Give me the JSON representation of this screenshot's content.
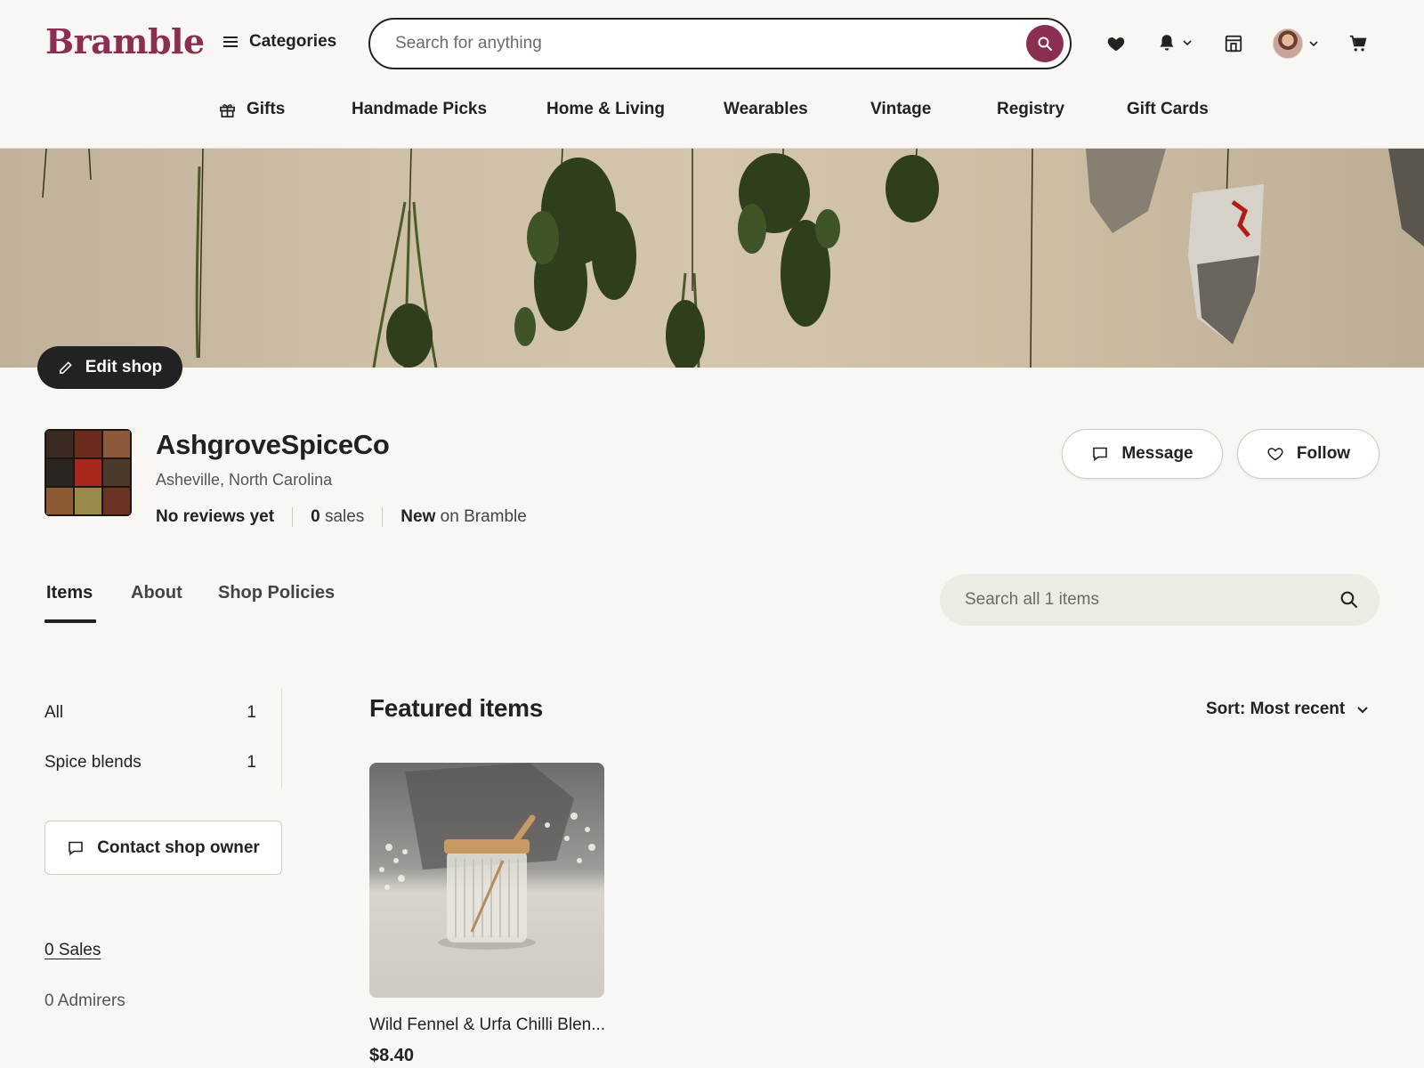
{
  "header": {
    "logo": "Bramble",
    "categories_label": "Categories",
    "search_placeholder": "Search for anything"
  },
  "icons": {
    "favorites": "heart-icon",
    "notifications": "bell-icon",
    "shop_manager": "shop-icon",
    "account": "avatar",
    "cart": "cart-icon"
  },
  "colors": {
    "brand": "#8a2e52",
    "dark_button": "#222222",
    "background": "#f8f7f4"
  },
  "nav": {
    "items": [
      {
        "label": "Gifts",
        "icon": "gift-icon"
      },
      {
        "label": "Handmade Picks"
      },
      {
        "label": "Home & Living"
      },
      {
        "label": "Wearables"
      },
      {
        "label": "Vintage"
      },
      {
        "label": "Registry"
      },
      {
        "label": "Gift Cards"
      }
    ]
  },
  "banner": {
    "edit_label": "Edit shop"
  },
  "shop": {
    "name": "AshgroveSpiceCo",
    "location": "Asheville, North Carolina",
    "reviews": "No reviews yet",
    "sales_count": "0",
    "sales_word": "sales",
    "age_label": "New",
    "age_suffix": "on Bramble",
    "message_label": "Message",
    "follow_label": "Follow"
  },
  "tabs": [
    {
      "label": "Items",
      "active": true
    },
    {
      "label": "About",
      "active": false
    },
    {
      "label": "Shop Policies",
      "active": false
    }
  ],
  "shop_search": {
    "placeholder": "Search all 1 items"
  },
  "sidebar": {
    "sections": [
      {
        "label": "All",
        "count": "1"
      },
      {
        "label": "Spice blends",
        "count": "1"
      }
    ],
    "contact_label": "Contact shop owner",
    "sales_link": "0 Sales",
    "admirers": "0 Admirers"
  },
  "featured": {
    "title": "Featured items",
    "sort_label": "Sort: Most recent",
    "items": [
      {
        "title": "Wild Fennel & Urfa Chilli Blen...",
        "price": "$8.40"
      }
    ]
  }
}
